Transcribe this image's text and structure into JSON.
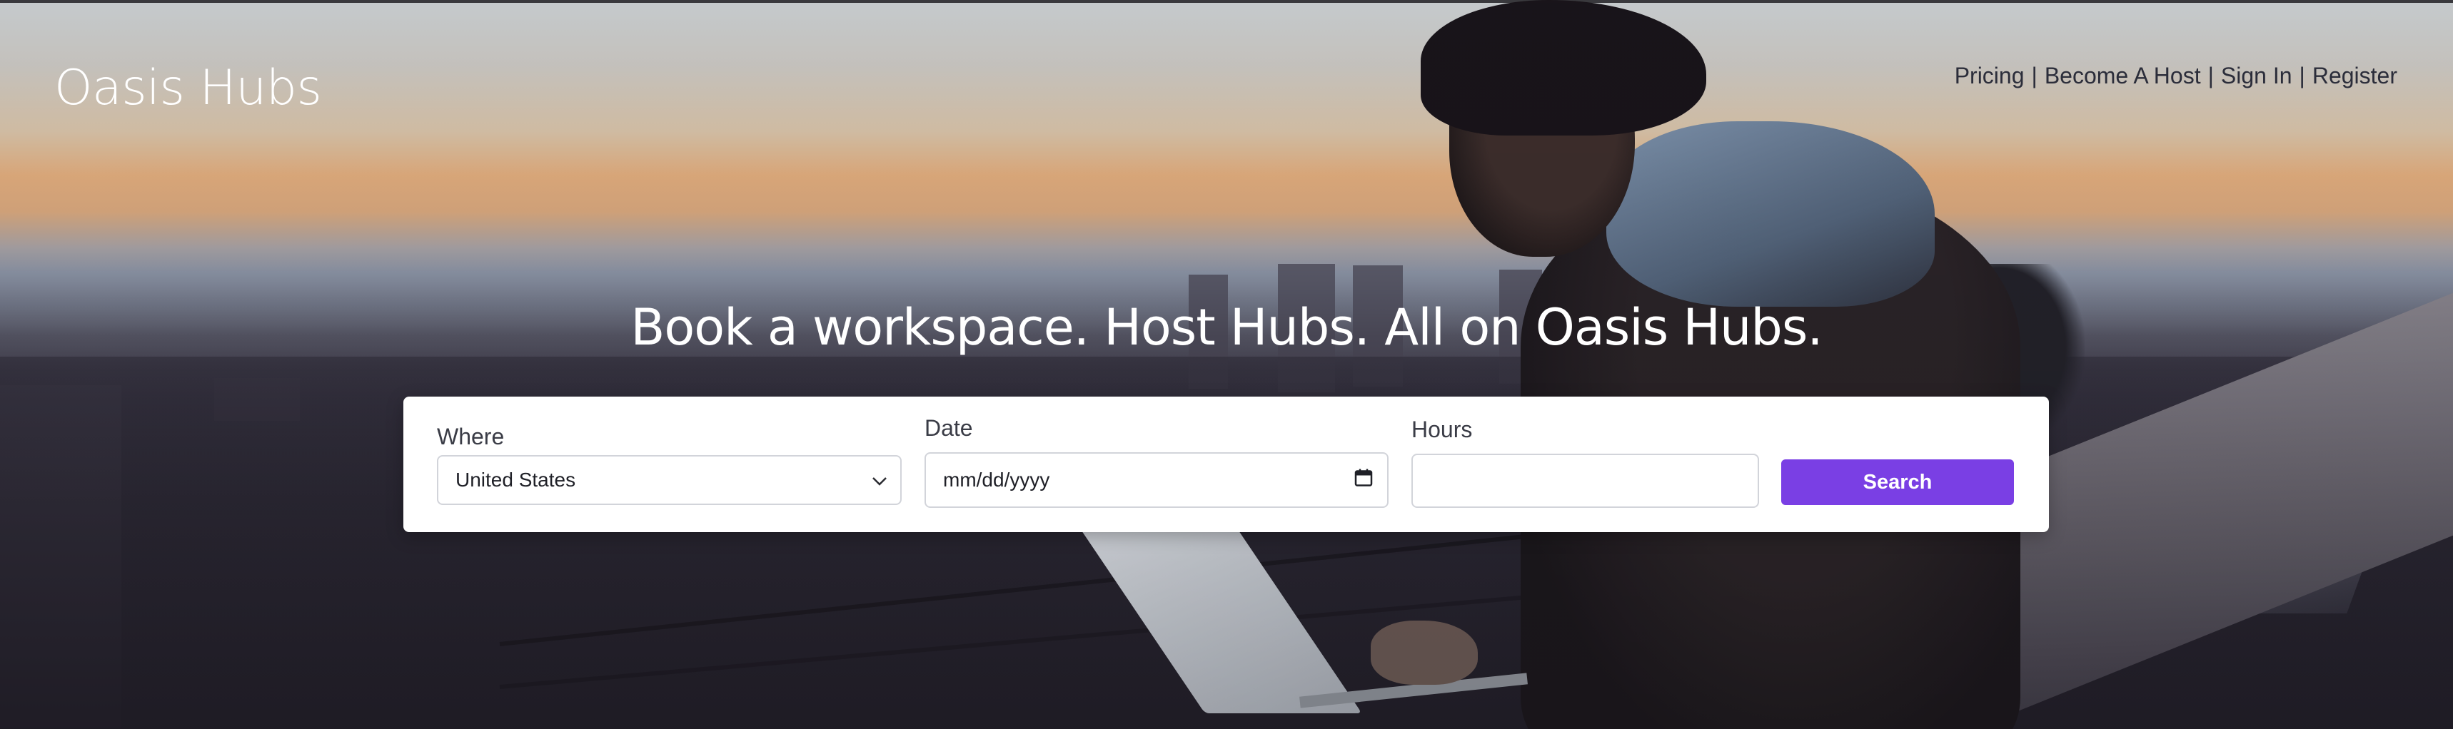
{
  "header": {
    "brand": "Oasis Hubs",
    "nav": [
      {
        "label": "Pricing"
      },
      {
        "label": "Become A Host"
      },
      {
        "label": "Sign In"
      },
      {
        "label": "Register"
      }
    ],
    "separator": "|",
    "nav_color": "#2b2d3a"
  },
  "hero": {
    "headline": "Book a workspace. Host Hubs. All on Oasis Hubs."
  },
  "search": {
    "where_label": "Where",
    "where_value": "United States",
    "date_label": "Date",
    "date_placeholder": "mm/dd/yyyy",
    "hours_label": "Hours",
    "hours_value": "",
    "button_label": "Search",
    "button_color": "#7a3fe4",
    "icons": {
      "select": "chevron-down-icon",
      "date": "calendar-icon"
    }
  }
}
